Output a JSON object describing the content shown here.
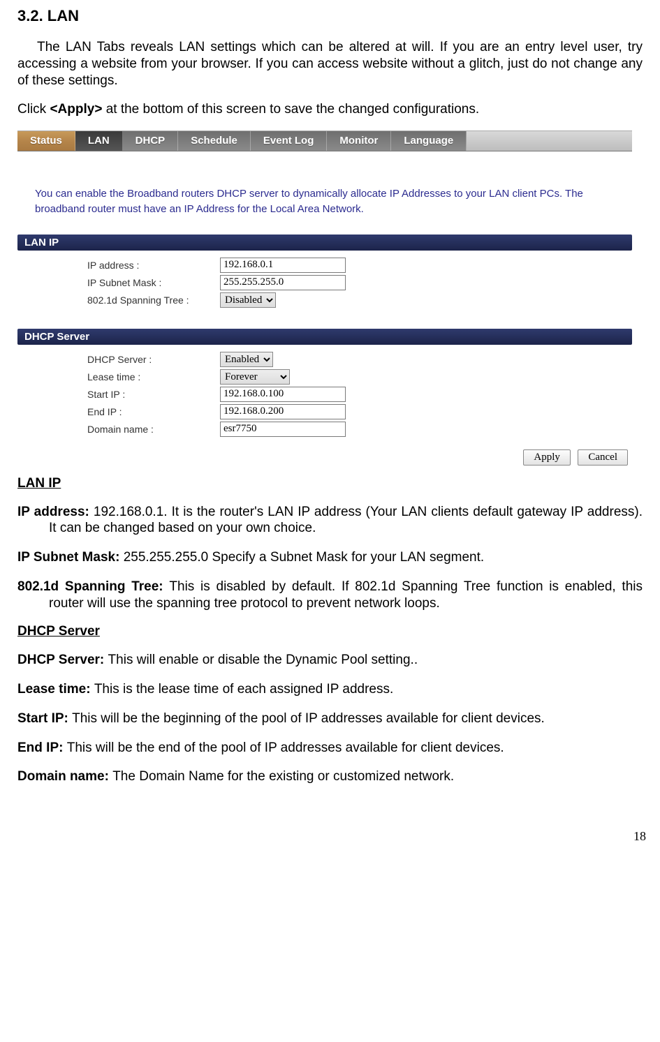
{
  "heading": "3.2.  LAN",
  "intro": "The LAN Tabs reveals LAN settings which can be altered at will. If you are an entry level user, try accessing a website from your browser. If you can access website without a glitch, just do not change any of these settings.",
  "apply_line_pre": "Click ",
  "apply_line_bold": "<Apply>",
  "apply_line_post": " at the bottom of this screen to save the changed configurations.",
  "tabs": {
    "t0": "Status",
    "t1": "LAN",
    "t2": "DHCP",
    "t3": "Schedule",
    "t4": "Event Log",
    "t5": "Monitor",
    "t6": "Language"
  },
  "panel_desc": "You can enable the Broadband routers DHCP server to dynamically allocate IP Addresses to your LAN client PCs. The broadband router must have an IP Address for the Local Area Network.",
  "hdr_lanip": "LAN IP",
  "hdr_dhcp": "DHCP Server",
  "lbl": {
    "ip": "IP address :",
    "mask": "IP Subnet Mask :",
    "stp": "802.1d Spanning Tree :",
    "srv": "DHCP Server :",
    "lease": "Lease time :",
    "sip": "Start IP :",
    "eip": "End IP :",
    "dom": "Domain name :"
  },
  "val": {
    "ip": "192.168.0.1",
    "mask": "255.255.255.0",
    "stp": "Disabled",
    "srv": "Enabled",
    "lease": "Forever",
    "sip": "192.168.0.100",
    "eip": "192.168.0.200",
    "dom": "esr7750"
  },
  "btn": {
    "apply": "Apply",
    "cancel": "Cancel"
  },
  "sec_lanip": "LAN IP",
  "desc_ip_b": "IP address: ",
  "desc_ip_t": "192.168.0.1. It is the router's LAN IP address (Your LAN clients default gateway IP address). It can be changed based on your own choice.",
  "desc_mask_b": "IP Subnet Mask: ",
  "desc_mask_t": "255.255.255.0 Specify a Subnet Mask for your LAN segment.",
  "desc_stp_b": "802.1d Spanning Tree: ",
  "desc_stp_t": "This is disabled by default. If 802.1d Spanning Tree function is enabled, this router will use the spanning tree protocol to prevent network loops.",
  "sec_dhcp": "DHCP Server",
  "desc_srv_b": "DHCP Server: ",
  "desc_srv_t": "This will enable or disable the Dynamic Pool setting..",
  "desc_lease_b": "Lease time: ",
  "desc_lease_t": "This is the lease time of each assigned IP address.",
  "desc_sip_b": "Start IP: ",
  "desc_sip_t": "This will be the beginning of the pool of IP addresses available for client devices.",
  "desc_eip_b": "End IP: ",
  "desc_eip_t": "This will be the end of the pool of IP addresses available for client devices.",
  "desc_dom_b": "Domain name: ",
  "desc_dom_t": "The Domain Name for the existing or customized network.",
  "page_number": "18"
}
